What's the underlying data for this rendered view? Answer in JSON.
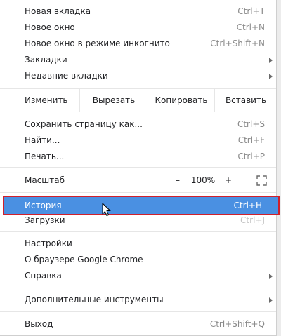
{
  "menu": {
    "top_items": [
      {
        "label": "Новая вкладка",
        "shortcut": "Ctrl+T"
      },
      {
        "label": "Новое окно",
        "shortcut": "Ctrl+N"
      },
      {
        "label": "Новое окно в режиме инкогнито",
        "shortcut": "Ctrl+Shift+N"
      },
      {
        "label": "Закладки",
        "shortcut": ""
      },
      {
        "label": "Недавние вкладки",
        "shortcut": ""
      }
    ],
    "edit": {
      "label": "Изменить",
      "cut": "Вырезать",
      "copy": "Копировать",
      "paste": "Вставить"
    },
    "page_items": [
      {
        "label": "Сохранить страницу как...",
        "shortcut": "Ctrl+S"
      },
      {
        "label": "Найти...",
        "shortcut": "Ctrl+F"
      },
      {
        "label": "Печать...",
        "shortcut": "Ctrl+P"
      }
    ],
    "zoom": {
      "label": "Масштаб",
      "minus": "–",
      "value": "100%",
      "plus": "+"
    },
    "highlighted": {
      "label": "История",
      "shortcut": "Ctrl+H"
    },
    "downloads": {
      "label": "Загрузки",
      "shortcut": "Ctrl+J"
    },
    "settings_items": [
      {
        "label": "Настройки"
      },
      {
        "label": "О браузере Google Chrome"
      },
      {
        "label": "Справка"
      }
    ],
    "tools": {
      "label": "Дополнительные инструменты"
    },
    "exit": {
      "label": "Выход",
      "shortcut": "Ctrl+Shift+Q"
    }
  },
  "colors": {
    "highlight_bg": "#4a90e2",
    "highlight_border": "#d01f2b",
    "shortcut_text": "#8a8a8a"
  }
}
